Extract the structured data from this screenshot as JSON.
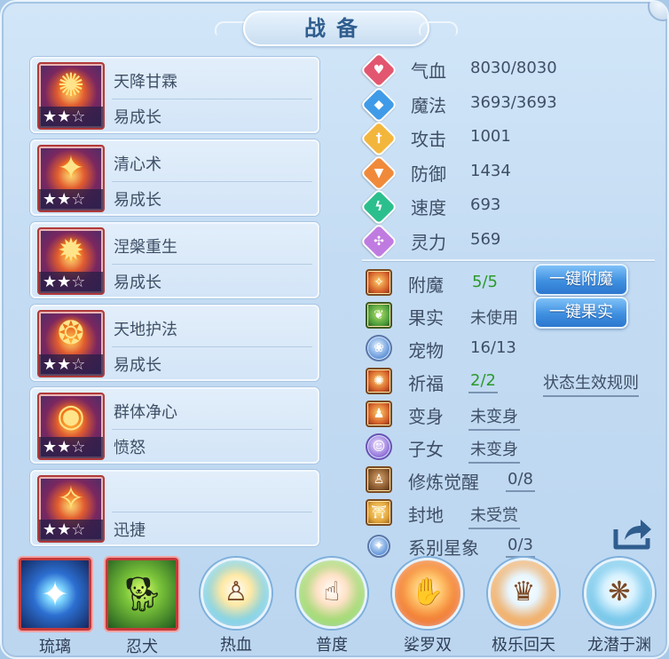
{
  "title": "战备",
  "equipment": [
    {
      "name": "天降甘霖",
      "growth": "易成长",
      "stars_filled": 2,
      "stars_total": 3,
      "glyph": "✺"
    },
    {
      "name": "清心术",
      "growth": "易成长",
      "stars_filled": 2,
      "stars_total": 3,
      "glyph": "✦"
    },
    {
      "name": "涅槃重生",
      "growth": "易成长",
      "stars_filled": 2,
      "stars_total": 3,
      "glyph": "✹"
    },
    {
      "name": "天地护法",
      "growth": "易成长",
      "stars_filled": 2,
      "stars_total": 3,
      "glyph": "❂"
    },
    {
      "name": "群体净心",
      "growth": "愤怒",
      "stars_filled": 2,
      "stars_total": 3,
      "glyph": "◉"
    },
    {
      "name": "",
      "growth": "迅捷",
      "stars_filled": 2,
      "stars_total": 3,
      "glyph": "✧"
    }
  ],
  "stats": [
    {
      "label": "气血",
      "value": "8030/8030",
      "icon": "heart-icon",
      "color": "#e2576f"
    },
    {
      "label": "魔法",
      "value": "3693/3693",
      "icon": "mana-icon",
      "color": "#3f9be8"
    },
    {
      "label": "攻击",
      "value": "1001",
      "icon": "sword-icon",
      "color": "#f3b63c"
    },
    {
      "label": "防御",
      "value": "1434",
      "icon": "shield-icon",
      "color": "#f08a3a"
    },
    {
      "label": "速度",
      "value": "693",
      "icon": "lightning-icon",
      "color": "#2cbf8e"
    },
    {
      "label": "灵力",
      "value": "569",
      "icon": "spirit-icon",
      "color": "#c07be0"
    }
  ],
  "extras": {
    "enchant": {
      "label": "附魔",
      "value": "5/5",
      "button": "一键附魔"
    },
    "fruit": {
      "label": "果实",
      "value": "未使用",
      "button": "一键果实"
    },
    "pet": {
      "label": "宠物",
      "value": "16/13"
    },
    "blessing": {
      "label": "祈福",
      "value": "2/2",
      "link": "状态生效规则"
    },
    "transform": {
      "label": "变身",
      "value": "未变身"
    },
    "children": {
      "label": "子女",
      "value": "未变身"
    },
    "cultivation": {
      "label": "修炼觉醒",
      "value": "0/8"
    },
    "fief": {
      "label": "封地",
      "value": "未受赏"
    },
    "constellation": {
      "label": "系别星象",
      "value": "0/3"
    }
  },
  "tabs": [
    {
      "label": "琉璃",
      "style": "square-blue",
      "selected": true
    },
    {
      "label": "忍犬",
      "style": "square-green",
      "selected": true
    },
    {
      "label": "热血",
      "style": "orb"
    },
    {
      "label": "普度",
      "style": "orb"
    },
    {
      "label": "娑罗双",
      "style": "orb"
    },
    {
      "label": "极乐回天",
      "style": "orb"
    },
    {
      "label": "龙潜于渊",
      "style": "orb"
    }
  ]
}
